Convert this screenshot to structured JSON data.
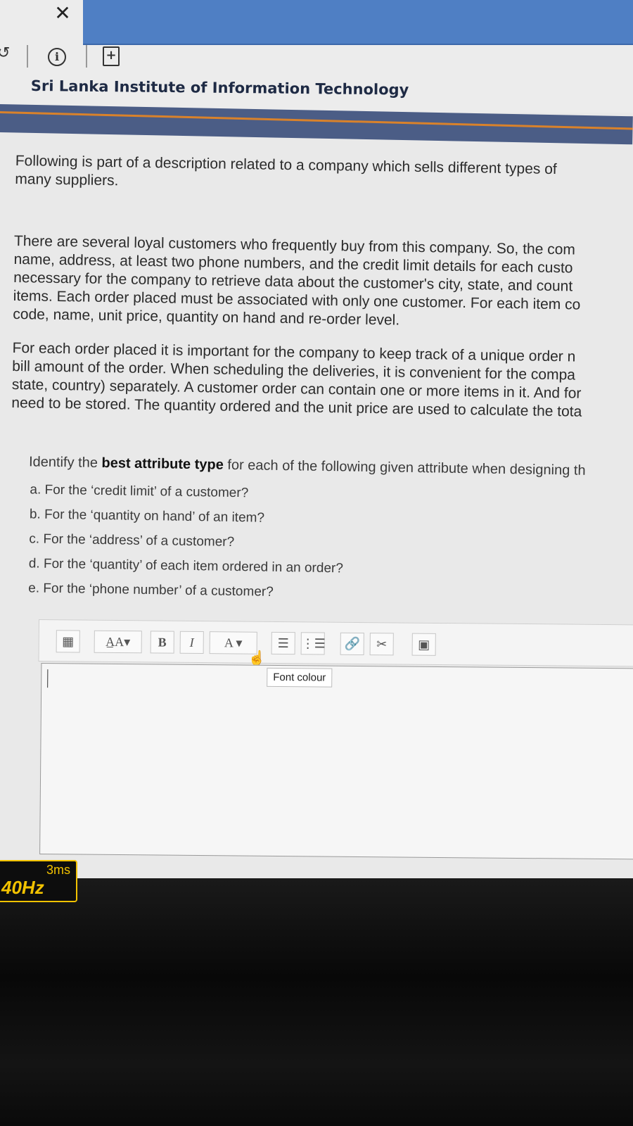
{
  "browser": {
    "site_name": "Sri Lanka Institute of Information Technology"
  },
  "question": {
    "intro": [
      "Following is part of a description related to a company which sells different types of",
      "many suppliers."
    ],
    "paragraph1": [
      "There are several loyal customers who frequently buy from this company. So, the com",
      "name, address, at least two phone numbers, and the credit limit details for each custo",
      "necessary for the company to retrieve data about the customer's city, state, and count",
      "items. Each order placed must be associated with only one customer. For each item co",
      "code, name, unit price, quantity on hand and re-order level."
    ],
    "paragraph2": [
      "For each order placed it is important for the company to keep track of a unique order n",
      "bill amount of the order. When scheduling the deliveries, it is convenient for the compa",
      "state, country) separately. A customer order can contain one or more items in it. And for",
      "need to be stored. The quantity ordered and the unit price are used to calculate the tota"
    ],
    "prompt_prefix": "Identify the ",
    "prompt_bold": "best attribute type",
    "prompt_suffix": " for each of the following given attribute when designing th",
    "items": [
      "a. For the ‘credit limit’ of a customer?",
      "b. For the ‘quantity on hand’ of an item?",
      "c. For the ‘address’ of a customer?",
      "d. For the ‘quantity’ of each item ordered in an order?",
      "e. For the ‘phone number’ of a customer?"
    ]
  },
  "editor": {
    "font_size_label": "A̲A▾",
    "bold_label": "B",
    "italic_label": "I",
    "font_colour_label": "A ▾",
    "tooltip": "Font colour",
    "answer_text": ""
  },
  "monitor_overlay": {
    "response_time": "3ms",
    "refresh_rate": "40Hz"
  }
}
